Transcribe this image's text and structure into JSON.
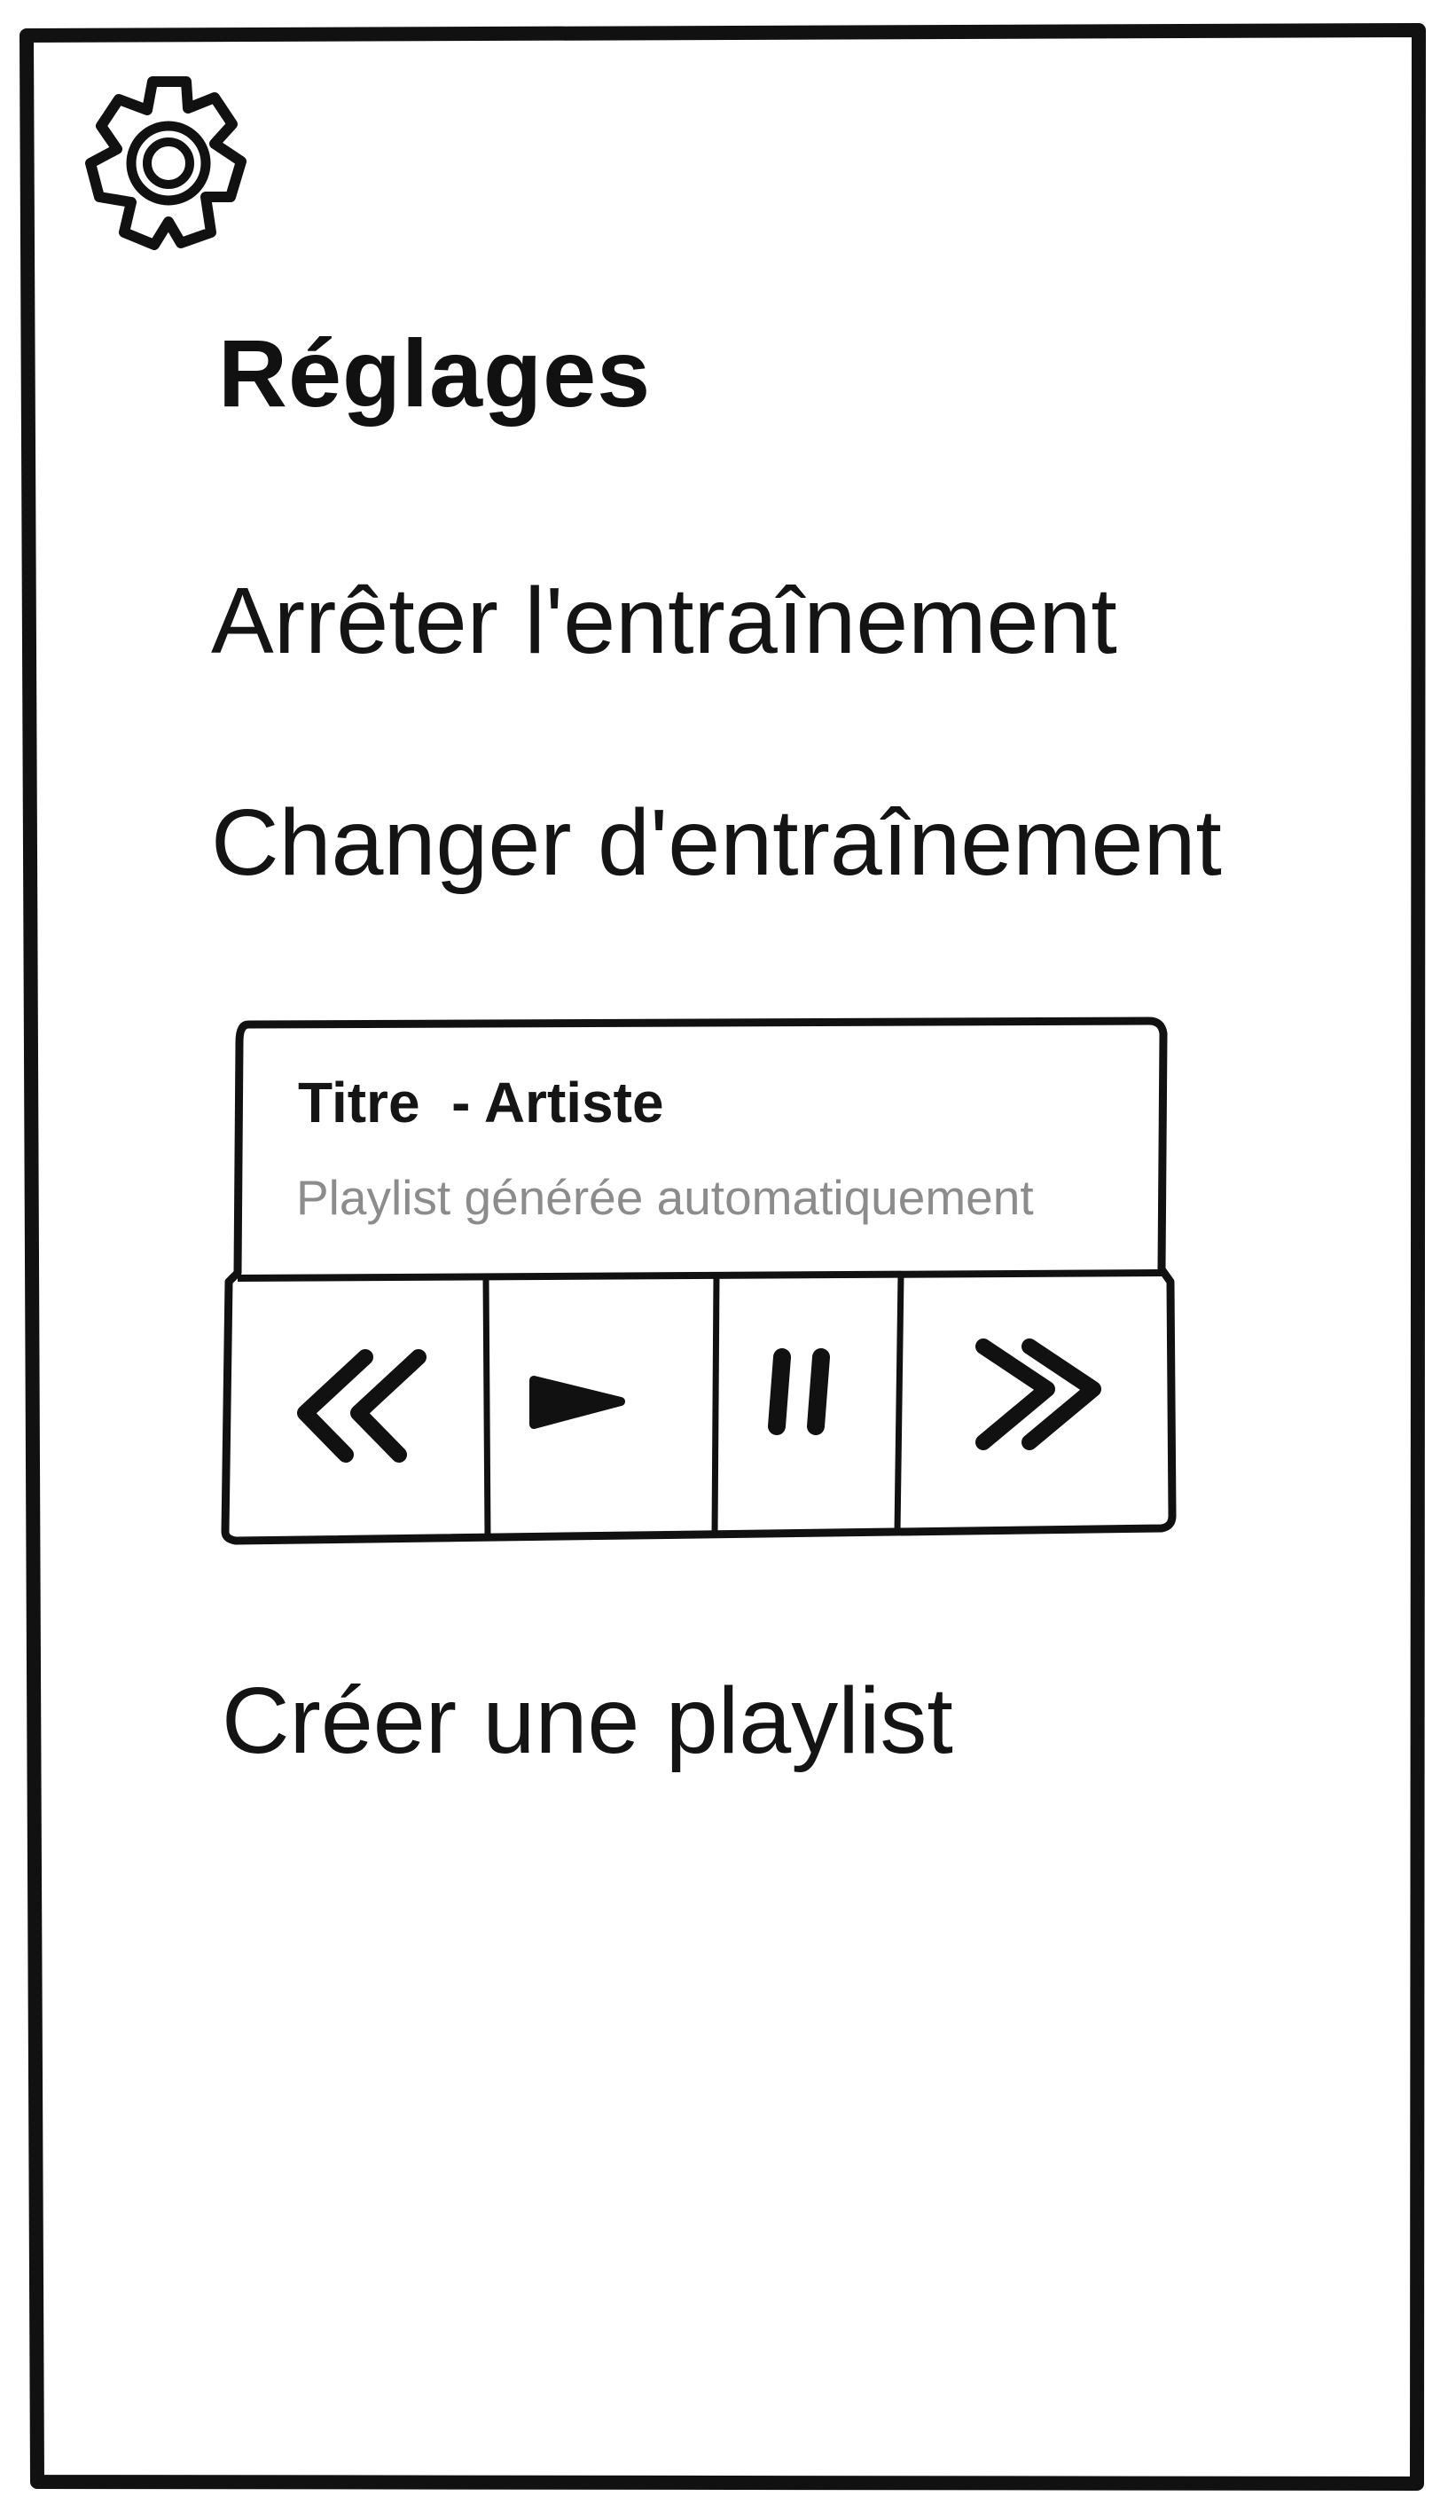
{
  "header": {
    "icon": "gear-icon",
    "title": "Réglages"
  },
  "menu": {
    "stop_training": "Arrêter l'entraînement",
    "change_training": "Changer d'entraînement",
    "create_playlist": "Créer une playlist"
  },
  "player": {
    "track_title": "Titre  - Artiste",
    "subtitle": "Playlist générée automatiquement",
    "controls": {
      "previous_icon": "rewind-icon",
      "play_icon": "play-icon",
      "pause_icon": "pause-icon",
      "next_icon": "fast-forward-icon"
    }
  },
  "colors": {
    "ink": "#111111",
    "subtitle_gray": "#8c8c8c",
    "background": "#ffffff"
  }
}
